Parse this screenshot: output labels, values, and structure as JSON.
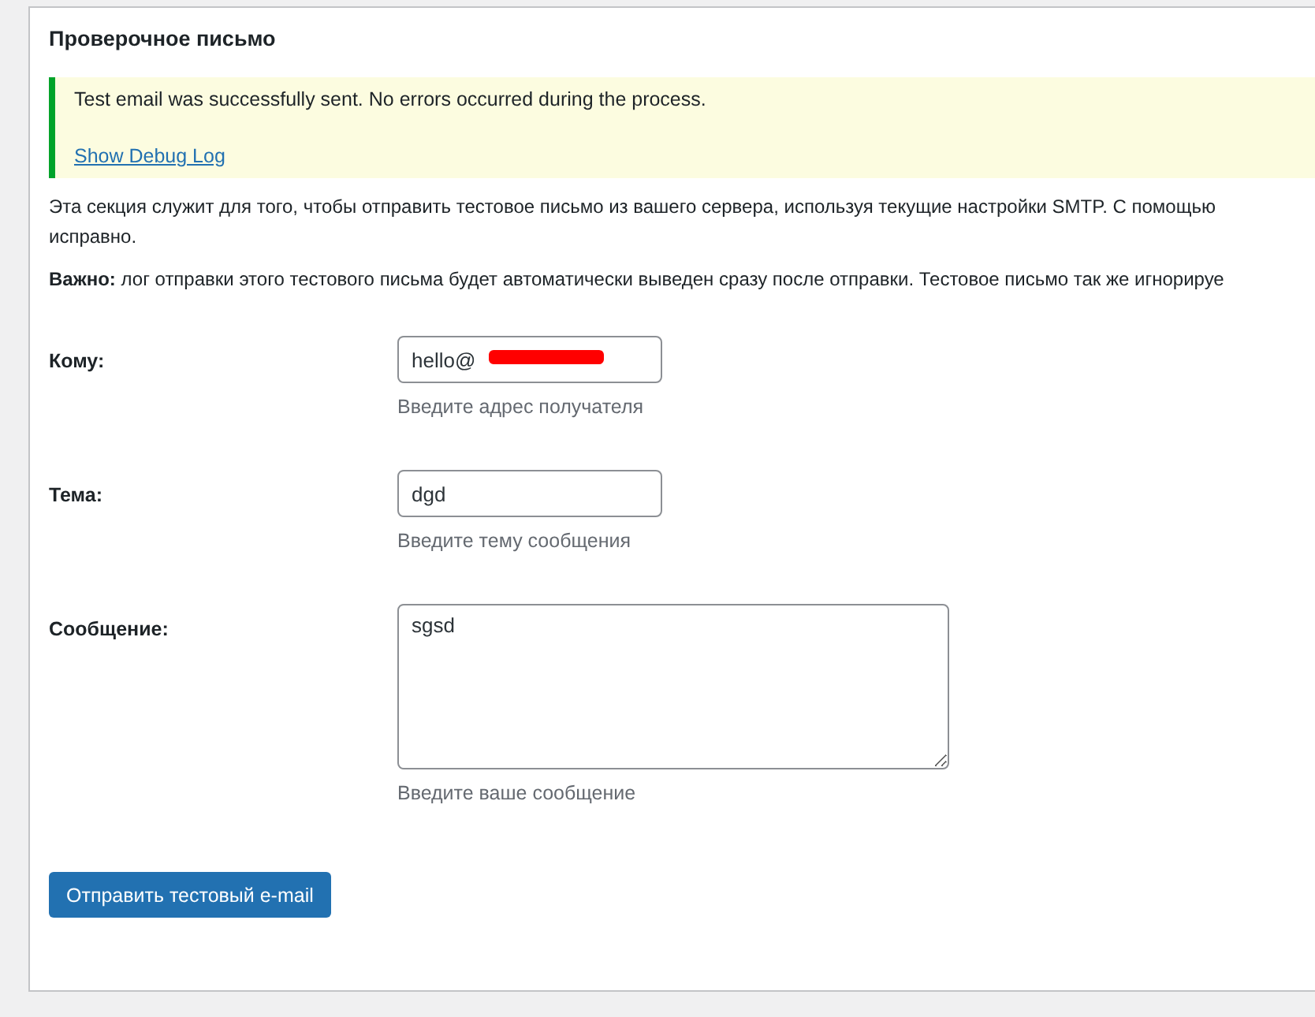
{
  "section_title": "Проверочное письмо",
  "notice": {
    "message": "Test email was successfully sent. No errors occurred during the process.",
    "link": "Show Debug Log"
  },
  "paragraphs": [
    "Эта секция служит для того, чтобы отправить тестовое письмо из вашего сервера, используя текущие настройки SMTP. С помощью",
    "исправно.",
    "**Важно:** лог отправки этого тестового письма будет автоматически выведен сразу после отправки. Тестовое письмо так же игнорируе"
  ],
  "fields": [
    {
      "label": "Кому:",
      "kind": "input",
      "value": "hello@",
      "redacted": true,
      "hint": "Введите адрес получателя"
    },
    {
      "label": "Тема:",
      "kind": "input",
      "value": "dgd",
      "redacted": false,
      "hint": "Введите тему сообщения"
    },
    {
      "label": "Сообщение:",
      "kind": "textarea",
      "value": "sgsd",
      "redacted": false,
      "hint": "Введите ваше сообщение"
    }
  ],
  "button": "Отправить тестовый e-mail"
}
